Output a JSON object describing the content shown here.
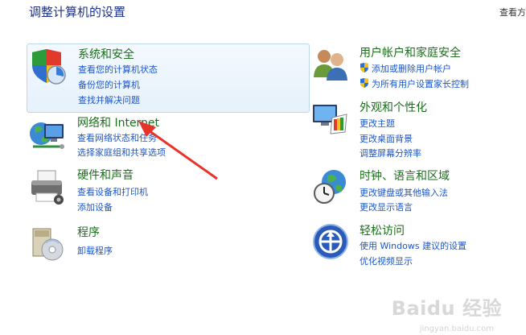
{
  "header": {
    "title": "调整计算机的设置",
    "view_by": "查看方式"
  },
  "categories": [
    {
      "title": "系统和安全",
      "icon": "shield-computer-icon",
      "links": [
        "查看您的计算机状态",
        "备份您的计算机",
        "查找并解决问题"
      ]
    },
    {
      "title": "网络和 Internet",
      "icon": "network-globe-icon",
      "links": [
        "查看网络状态和任务",
        "选择家庭组和共享选项"
      ]
    },
    {
      "title": "硬件和声音",
      "icon": "printer-icon",
      "links": [
        "查看设备和打印机",
        "添加设备"
      ]
    },
    {
      "title": "程序",
      "icon": "programs-icon",
      "links": [
        "卸载程序"
      ]
    },
    {
      "title": "用户帐户和家庭安全",
      "icon": "users-icon",
      "links": [
        "添加或删除用户帐户",
        "为所有用户设置家长控制"
      ]
    },
    {
      "title": "外观和个性化",
      "icon": "monitor-palette-icon",
      "links": [
        "更改主题",
        "更改桌面背景",
        "调整屏幕分辨率"
      ]
    },
    {
      "title": "时钟、语言和区域",
      "icon": "clock-globe-icon",
      "links": [
        "更改键盘或其他输入法",
        "更改显示语言"
      ]
    },
    {
      "title": "轻松访问",
      "icon": "ease-of-access-icon",
      "links": [
        "使用 Windows 建议的设置",
        "优化视频显示"
      ]
    }
  ],
  "annotation": {
    "arrow_color": "#e8332a"
  },
  "watermark": {
    "text": "Baidu 经验",
    "sub": "jingyan.baidu.com"
  }
}
